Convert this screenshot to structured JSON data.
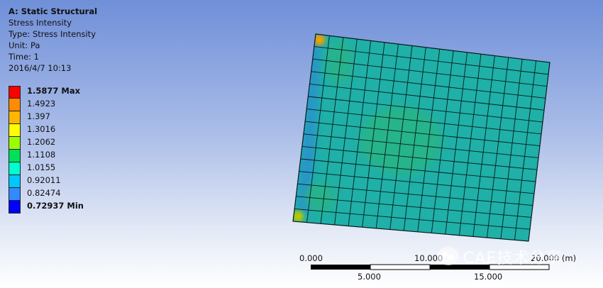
{
  "header": {
    "title": "A: Static Structural",
    "result": "Stress Intensity",
    "type": "Type: Stress Intensity",
    "unit": "Unit: Pa",
    "time": "Time: 1",
    "date": "2016/4/7 10:13"
  },
  "legend": [
    {
      "label": "1.5877 Max",
      "color": "#ff0000",
      "bold": true
    },
    {
      "label": "1.4923",
      "color": "#ff8c00",
      "bold": false
    },
    {
      "label": "1.397",
      "color": "#ffb700",
      "bold": false
    },
    {
      "label": "1.3016",
      "color": "#ffff00",
      "bold": false
    },
    {
      "label": "1.2062",
      "color": "#9cff00",
      "bold": false
    },
    {
      "label": "1.1108",
      "color": "#00e05a",
      "bold": false
    },
    {
      "label": "1.0155",
      "color": "#00ffd0",
      "bold": false
    },
    {
      "label": "0.92011",
      "color": "#00c8ff",
      "bold": false
    },
    {
      "label": "0.82474",
      "color": "#2f8cff",
      "bold": false
    },
    {
      "label": "0.72937 Min",
      "color": "#0000ff",
      "bold": true
    }
  ],
  "scale": {
    "labels_top": [
      "0.000",
      "10.000",
      "20.000 (m)"
    ],
    "labels_bottom": [
      "5.000",
      "15.000"
    ]
  },
  "watermark": {
    "text": "CAE技术分享"
  },
  "colors": {
    "base_face": "#1fb0a8",
    "mesh_line": "#0a1a1a"
  }
}
